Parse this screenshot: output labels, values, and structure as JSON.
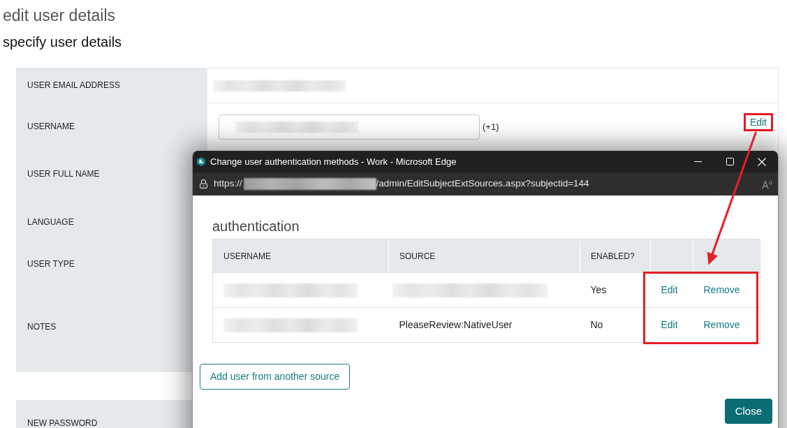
{
  "page_title": "edit user details",
  "section_title": "specify user details",
  "form": {
    "rows": [
      {
        "kind": "text",
        "label": "USER EMAIL ADDRESS",
        "value_redacted": true
      },
      {
        "kind": "input",
        "label": "USERNAME",
        "value_redacted": true,
        "suffix": "(+1)",
        "edit_link": {
          "label": "Edit",
          "highlighted": true
        }
      },
      {
        "kind": "label",
        "label": "USER FULL NAME"
      },
      {
        "kind": "label",
        "label": "LANGUAGE"
      },
      {
        "kind": "label",
        "label": "USER TYPE"
      },
      {
        "kind": "label",
        "label": "NOTES"
      }
    ],
    "password_rows": [
      {
        "label": "NEW PASSWORD"
      }
    ]
  },
  "popup": {
    "window_title": "Change user authentication methods - Work - Microsoft Edge",
    "url": {
      "scheme": "https://",
      "host_redacted": true,
      "path": "/admin/EditSubjectExtSources.aspx?subjectid=144"
    },
    "heading": "authentication",
    "table": {
      "columns": [
        "USERNAME",
        "SOURCE",
        "ENABLED?"
      ],
      "actions_highlighted": true,
      "rows": [
        {
          "cells": [
            {
              "redacted": true
            },
            {
              "redacted": true
            },
            {
              "text": "Yes"
            }
          ],
          "actions": [
            "Edit",
            "Remove"
          ]
        },
        {
          "cells": [
            {
              "redacted": true
            },
            {
              "text": "PleaseReview:NativeUser"
            },
            {
              "text": "No"
            }
          ],
          "actions": [
            "Edit",
            "Remove"
          ]
        }
      ]
    },
    "buttons": [
      {
        "kind": "outline",
        "label": "Add user from another source"
      },
      {
        "kind": "primary",
        "label": "Close"
      }
    ]
  },
  "annotation": {
    "arrow": true
  }
}
